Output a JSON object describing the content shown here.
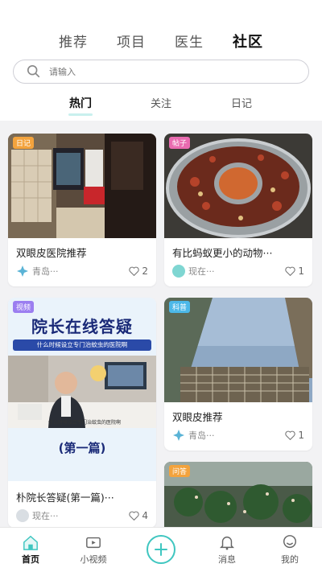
{
  "top_tabs": [
    {
      "label": "推荐"
    },
    {
      "label": "项目"
    },
    {
      "label": "医生"
    },
    {
      "label": "社区",
      "active": true
    }
  ],
  "search": {
    "placeholder": "请输入"
  },
  "sub_tabs": [
    {
      "label": "热门",
      "active": true
    },
    {
      "label": "关注"
    },
    {
      "label": "日记"
    }
  ],
  "cards": [
    {
      "badge": "日记",
      "badge_color": "#f3a33d",
      "title": "双眼皮医院推荐",
      "author": "青岛···",
      "likes": "2"
    },
    {
      "badge": "帖子",
      "badge_color": "#e96bb0",
      "title": "有比蚂蚁更小的动物···",
      "author": "现在···",
      "likes": "1"
    },
    {
      "badge": "视频",
      "badge_color": "#9b7ef0",
      "title": "朴院长答疑(第一篇)···",
      "author": "现在···",
      "likes": "4",
      "image_text": {
        "headline": "院长在线答疑",
        "subline": "什么时候设立专门治蚊虫的医院啊",
        "caption": "什么时候设立专门治蚊虫的医院啊",
        "episode": "(第一篇)"
      }
    },
    {
      "badge": "科普",
      "badge_color": "#4cb8e8",
      "title": "双眼皮推荐",
      "author": "青岛···",
      "likes": "1"
    },
    {
      "badge": "问答",
      "badge_color": "#f3a33d"
    }
  ],
  "bottom_nav": [
    {
      "label": "首页",
      "icon": "home-icon",
      "active": true
    },
    {
      "label": "小视频",
      "icon": "video-icon"
    },
    {
      "label": "消息",
      "icon": "bell-icon"
    },
    {
      "label": "我的",
      "icon": "profile-icon"
    }
  ],
  "colors": {
    "accent": "#3fc6c0"
  }
}
